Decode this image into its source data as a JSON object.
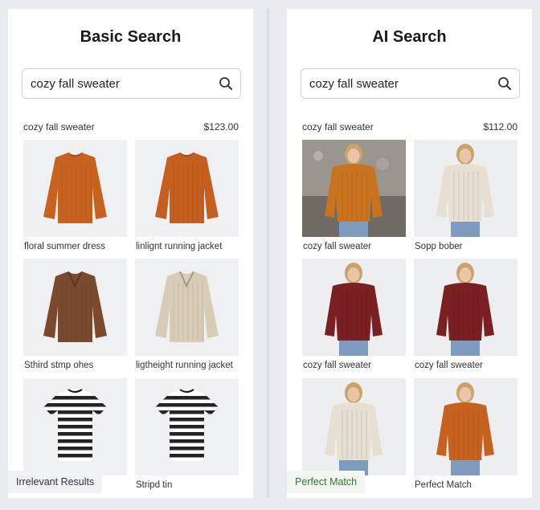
{
  "left_panel": {
    "title": "Basic Search",
    "search": {
      "value": "cozy fall sweater",
      "placeholder": ""
    },
    "result_query": "cozy fall sweater",
    "result_price": "$123.00",
    "items": [
      {
        "caption": "floral summer dress",
        "image": "orange-knit-sweater",
        "color": "#c8631f"
      },
      {
        "caption": "linlignt running jacket",
        "image": "orange-knit-sweater",
        "color": "#c55f20"
      },
      {
        "caption": "Sthird stmp ohes",
        "image": "brown-vneck-sweater",
        "color": "#7a4a2e"
      },
      {
        "caption": "ligtheight running jacket",
        "image": "beige-vneck-sweater",
        "color": "#d9ccb6"
      },
      {
        "caption": "",
        "image": "striped-tshirt",
        "color": "#111111"
      },
      {
        "caption": "Stripd tin",
        "image": "striped-tshirt",
        "color": "#111111"
      }
    ],
    "footer_label": "Irrelevant Results"
  },
  "right_panel": {
    "title": "AI Search",
    "search": {
      "value": "cozy fall sweater",
      "placeholder": ""
    },
    "result_query": "cozy fall sweater",
    "result_price": "$112.00",
    "items": [
      {
        "caption": "cozy fall sweater",
        "image": "model-orange-sweater-on-rocks",
        "color": "#c8741f"
      },
      {
        "caption": "Sopp bober",
        "image": "model-cream-sweater",
        "color": "#e6dfd2"
      },
      {
        "caption": "cozy fall sweater",
        "image": "model-burgundy-sweater",
        "color": "#7a1f22"
      },
      {
        "caption": "cozy fall sweater",
        "image": "model-burgundy-sweater",
        "color": "#7a1f22"
      },
      {
        "caption": "",
        "image": "model-cream-sweater",
        "color": "#e6dfd2"
      },
      {
        "caption": "Perfect Match",
        "image": "model-orange-sweater",
        "color": "#c6621f"
      }
    ],
    "footer_label": "Perfect Match"
  },
  "colors": {
    "background": "#e9ebee",
    "panel": "#ffffff",
    "perfect_match": "#2d7a2d"
  }
}
